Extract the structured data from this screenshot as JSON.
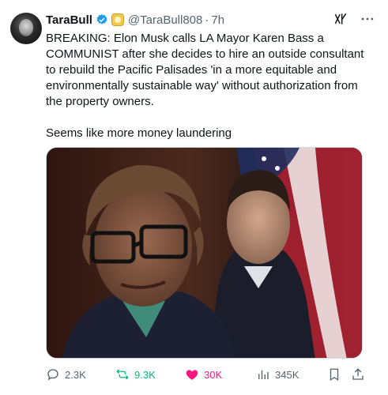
{
  "tweet": {
    "author_name": "TaraBull",
    "handle": "@TaraBull808",
    "separator": "·",
    "time": "7h",
    "text": "BREAKING: Elon Musk calls LA Mayor Karen Bass a COMMUNIST after she decides to hire an outside consultant to rebuild the Pacific Palisades 'in a more equitable and environmentally sustainable way' without authorization from the property owners.\n\nSeems like more money laundering"
  },
  "actions": {
    "replies": "2.3K",
    "reposts": "9.3K",
    "likes": "30K",
    "views": "345K"
  },
  "colors": {
    "verified": "#1d9bf0",
    "repost_active": "#00ba7c",
    "like_active": "#f91880",
    "muted": "#536471"
  },
  "icons": {
    "verified": "verified-badge-icon",
    "affiliate": "affiliate-badge-icon",
    "grok": "grok-icon",
    "more": "more-icon",
    "reply": "reply-icon",
    "repost": "repost-icon",
    "like": "heart-icon",
    "views": "views-icon",
    "bookmark": "bookmark-icon",
    "share": "share-icon"
  }
}
